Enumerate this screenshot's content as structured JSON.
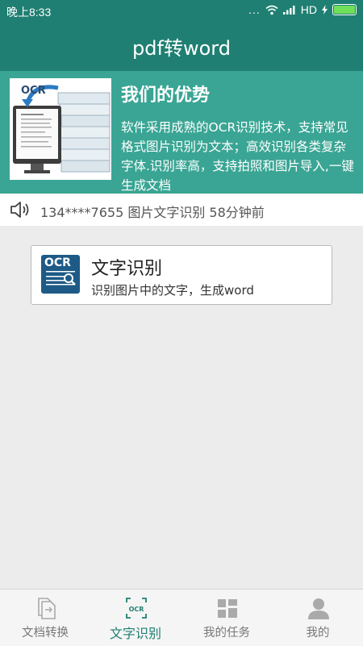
{
  "status_bar": {
    "time": "晚上8:33",
    "dots": "...",
    "network": "HD"
  },
  "header": {
    "title": "pdf转word"
  },
  "banner": {
    "image_label": "OCR",
    "title": "我们的优势",
    "description": "软件采用成熟的OCR识别技术，支持常见格式图片识别为文本；高效识别各类复杂字体.识别率高，支持拍照和图片导入,一键生成文档"
  },
  "ticker": {
    "text": "134****7655  图片文字识别  58分钟前"
  },
  "ocr_card": {
    "logo_text": "OCR",
    "title": "文字识别",
    "subtitle": "识别图片中的文字，生成word"
  },
  "bottom_nav": {
    "items": [
      {
        "label": "文档转换",
        "icon": "document-convert-icon"
      },
      {
        "label": "文字识别",
        "icon": "ocr-scan-icon",
        "active": true
      },
      {
        "label": "我的任务",
        "icon": "task-grid-icon"
      },
      {
        "label": "我的",
        "icon": "user-icon"
      }
    ]
  },
  "colors": {
    "primary": "#1f7f72",
    "banner": "#3aa594",
    "ocr_logo": "#1e5a86",
    "battery": "#6fe05a"
  }
}
